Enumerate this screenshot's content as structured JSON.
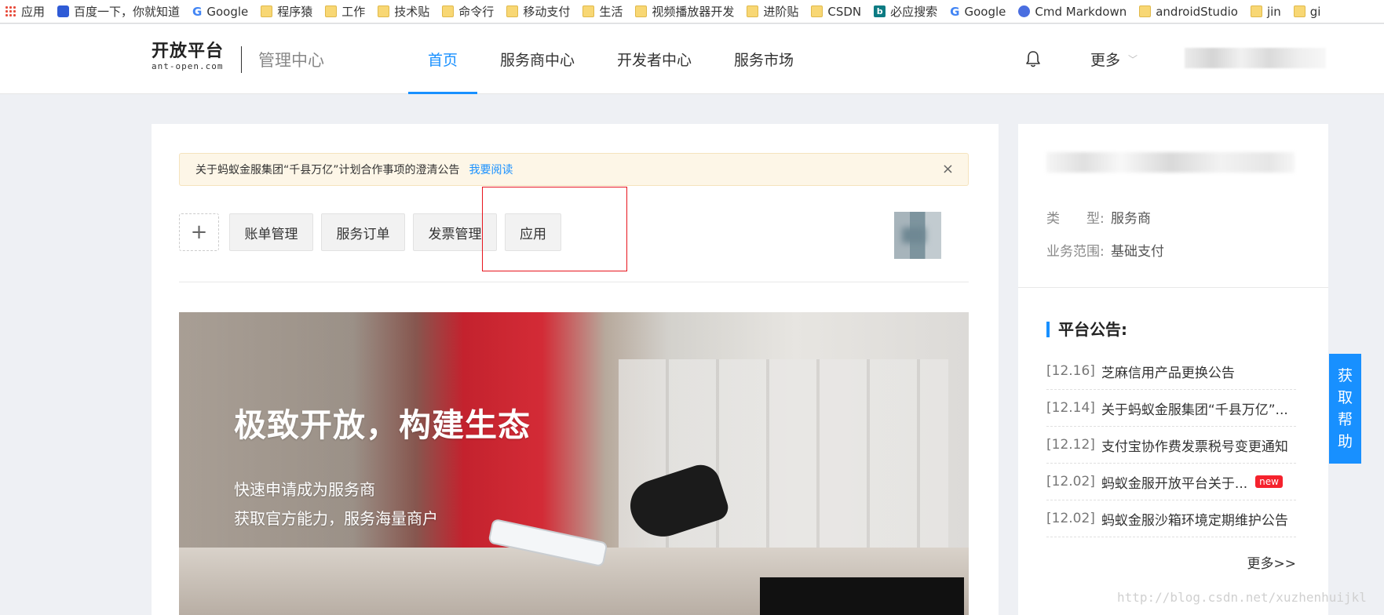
{
  "bookmarks": [
    {
      "label": "应用",
      "icon": "apps-grid-icon"
    },
    {
      "label": "百度一下，你就知道",
      "icon": "baidu-icon"
    },
    {
      "label": "Google",
      "icon": "google-icon"
    },
    {
      "label": "程序猿",
      "icon": "folder-icon"
    },
    {
      "label": "工作",
      "icon": "folder-icon"
    },
    {
      "label": "技术贴",
      "icon": "folder-icon"
    },
    {
      "label": "命令行",
      "icon": "folder-icon"
    },
    {
      "label": "移动支付",
      "icon": "folder-icon"
    },
    {
      "label": "生活",
      "icon": "folder-icon"
    },
    {
      "label": "视频播放器开发",
      "icon": "folder-icon"
    },
    {
      "label": "进阶贴",
      "icon": "folder-icon"
    },
    {
      "label": "CSDN",
      "icon": "folder-icon"
    },
    {
      "label": "必应搜索",
      "icon": "bing-icon"
    },
    {
      "label": "Google",
      "icon": "google-icon"
    },
    {
      "label": "Cmd Markdown",
      "icon": "cmd-markdown-icon"
    },
    {
      "label": "androidStudio",
      "icon": "folder-icon"
    },
    {
      "label": "jin",
      "icon": "folder-icon"
    },
    {
      "label": "gi",
      "icon": "folder-icon"
    }
  ],
  "header": {
    "logo_main": "开放平台",
    "logo_sub": "ant-open.com",
    "section": "管理中心",
    "nav": [
      "首页",
      "服务商中心",
      "开发者中心",
      "服务市场"
    ],
    "active_nav": "首页",
    "more": "更多",
    "icons": {
      "bell": "bell-icon",
      "more_chevron": "chevron-down-icon"
    }
  },
  "notice": {
    "text": "关于蚂蚁金服集团“千县万亿”计划合作事项的澄清公告",
    "link": "我要阅读",
    "close": "×"
  },
  "quick_actions": {
    "add": "+",
    "items": [
      "账单管理",
      "服务订单",
      "发票管理",
      "应用"
    ]
  },
  "banner": {
    "title": "极致开放，构建生态",
    "subtitle_lines": [
      "快速申请成为服务商",
      "获取官方能力，服务海量商户"
    ]
  },
  "account": {
    "type_label": "类　　型:",
    "type_value": "服务商",
    "scope_label": "业务范围:",
    "scope_value": "基础支付"
  },
  "announcements": {
    "title": "平台公告:",
    "items": [
      {
        "date": "[12.16]",
        "text": "芝麻信用产品更换公告",
        "badge": ""
      },
      {
        "date": "[12.14]",
        "text": "关于蚂蚁金服集团“千县万亿”...",
        "badge": ""
      },
      {
        "date": "[12.12]",
        "text": "支付宝协作费发票税号变更通知",
        "badge": ""
      },
      {
        "date": "[12.02]",
        "text": "蚂蚁金服开放平台关于...",
        "badge": "new"
      },
      {
        "date": "[12.02]",
        "text": "蚂蚁金服沙箱环境定期维护公告",
        "badge": ""
      }
    ],
    "more": "更多>>"
  },
  "help_tab": "获取帮助",
  "watermark": "http://blog.csdn.net/xuzhenhuijkl",
  "colors": {
    "accent": "#1890ff",
    "annotation_box": "#e8141d",
    "badge": "#f5222d",
    "notice_bg": "#fdf6e7"
  }
}
